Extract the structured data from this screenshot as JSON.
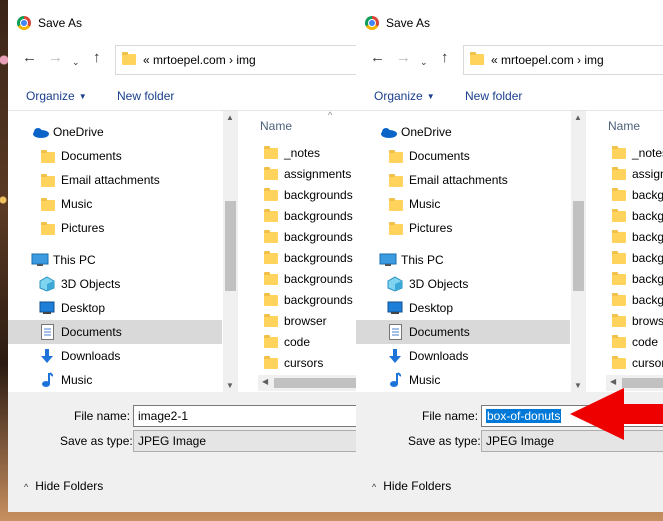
{
  "left_dialog": {
    "title": "Save As",
    "breadcrumb": "«  mrtoepel.com  ›  img",
    "toolbar": {
      "organize": "Organize",
      "new_folder": "New folder"
    },
    "nav_items": [
      {
        "label": "OneDrive",
        "icon": "onedrive-icon"
      },
      {
        "label": "Documents",
        "icon": "folder-icon"
      },
      {
        "label": "Email attachments",
        "icon": "folder-icon"
      },
      {
        "label": "Music",
        "icon": "folder-icon"
      },
      {
        "label": "Pictures",
        "icon": "folder-icon"
      },
      {
        "label": "This PC",
        "icon": "computer-icon"
      },
      {
        "label": "3D Objects",
        "icon": "3d-objects-icon"
      },
      {
        "label": "Desktop",
        "icon": "desktop-icon"
      },
      {
        "label": "Documents",
        "icon": "documents-icon",
        "selected": true
      },
      {
        "label": "Downloads",
        "icon": "downloads-icon"
      },
      {
        "label": "Music",
        "icon": "music-icon"
      }
    ],
    "column_header": "Name",
    "files": [
      "_notes",
      "assignments",
      "backgrounds",
      "backgrounds",
      "backgrounds",
      "backgrounds",
      "backgrounds",
      "backgrounds",
      "browser",
      "code",
      "cursors"
    ],
    "file_name_label": "File name:",
    "file_name_value": "image2-1",
    "save_as_type_label": "Save as type:",
    "save_as_type_value": "JPEG Image",
    "hide_folders": "Hide Folders"
  },
  "right_dialog": {
    "title": "Save As",
    "breadcrumb": "«  mrtoepel.com  ›  img",
    "toolbar": {
      "organize": "Organize",
      "new_folder": "New folder"
    },
    "nav_items": [
      {
        "label": "OneDrive"
      },
      {
        "label": "Documents"
      },
      {
        "label": "Email attachments"
      },
      {
        "label": "Music"
      },
      {
        "label": "Pictures"
      },
      {
        "label": "This PC"
      },
      {
        "label": "3D Objects"
      },
      {
        "label": "Desktop"
      },
      {
        "label": "Documents",
        "selected": true
      },
      {
        "label": "Downloads"
      },
      {
        "label": "Music"
      }
    ],
    "column_header": "Name",
    "files": [
      "_notes",
      "assign",
      "backgr",
      "backgr",
      "backgr",
      "backgr",
      "backgr",
      "backgr",
      "browse",
      "code",
      "cursor"
    ],
    "file_name_label": "File name:",
    "file_name_value": "box-of-donuts",
    "save_as_type_label": "Save as type:",
    "save_as_type_value": "JPEG Image",
    "hide_folders": "Hide Folders"
  },
  "colors": {
    "accent": "#0078d7",
    "selection": "#d9d9d9",
    "annotation_arrow": "#ee0000",
    "link": "#1a3f8c"
  }
}
